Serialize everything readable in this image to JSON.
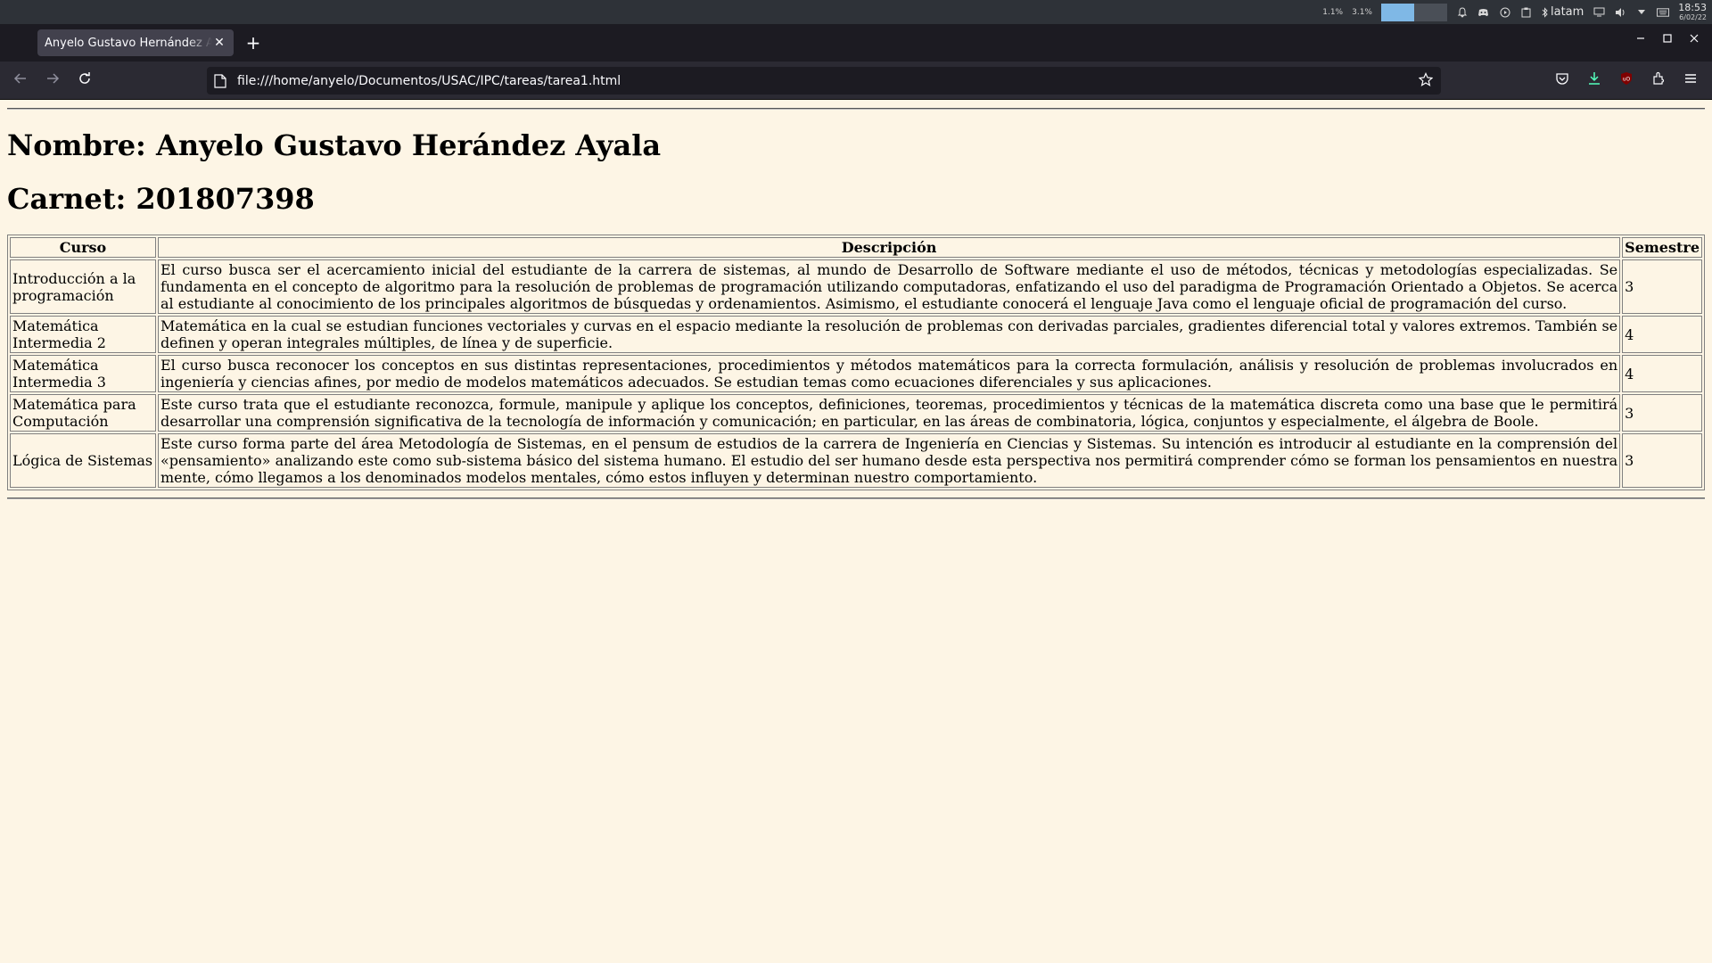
{
  "system_panel": {
    "cpu": "1.1%",
    "net": "3.1%",
    "mem_fill": 0.5,
    "keyboard": "latam",
    "time": "18:53",
    "date": "6/02/22"
  },
  "browser": {
    "tab_title": "Anyelo Gustavo Hernández Ayala",
    "url": "file:///home/anyelo/Documentos/USAC/IPC/tareas/tarea1.html",
    "accent": "#2b2a33"
  },
  "page": {
    "name_heading": "Nombre: Anyelo Gustavo Herández Ayala",
    "carnet_heading": "Carnet: 201807398",
    "table": {
      "headers": [
        "Curso",
        "Descripción",
        "Semestre"
      ],
      "rows": [
        {
          "curso": "Introducción a la programación",
          "descripcion": "El curso busca ser el acercamiento inicial del estudiante de la carrera de sistemas, al mundo de Desarrollo de Software mediante el uso de métodos, técnicas y metodologías especializadas. Se fundamenta en el concepto de algoritmo para la resolución de problemas de programación utilizando computadoras, enfatizando el uso del paradigma de Programación Orientado a Objetos. Se acerca al estudiante al conocimiento de los principales algoritmos de búsquedas y ordenamientos. Asimismo, el estudiante conocerá el lenguaje Java como el lenguaje oficial de programación del curso.",
          "semestre": "3"
        },
        {
          "curso": "Matemática Intermedia 2",
          "descripcion": "Matemática en la cual se estudian funciones vectoriales y curvas en el espacio mediante la resolución de problemas con derivadas parciales, gradientes diferencial total y valores extremos. También se definen y operan integrales múltiples, de línea y de superficie.",
          "semestre": "4"
        },
        {
          "curso": "Matemática Intermedia 3",
          "descripcion": "El curso busca reconocer los conceptos en sus distintas representaciones, procedimientos y métodos matemáticos para la correcta formulación, análisis y resolución de problemas involucrados en ingeniería y ciencias afines, por medio de modelos matemáticos adecuados. Se estudian temas como ecuaciones diferenciales y sus aplicaciones.",
          "semestre": "4"
        },
        {
          "curso": "Matemática para Computación",
          "descripcion": "Este curso trata que el estudiante reconozca, formule, manipule y aplique los conceptos, definiciones, teoremas, procedimientos y técnicas de la matemática discreta como una base que le permitirá desarrollar una comprensión significativa de la tecnología de información y comunicación; en particular, en las áreas de combinatoria, lógica, conjuntos y especialmente, el álgebra de Boole.",
          "semestre": "3"
        },
        {
          "curso": "Lógica de Sistemas",
          "descripcion": "Este curso forma parte del área Metodología de Sistemas, en el pensum de estudios de la carrera de Ingeniería en Ciencias y Sistemas. Su intención es introducir al estudiante en la comprensión del «pensamiento» analizando este como sub-sistema básico del sistema humano. El estudio del ser humano desde esta perspectiva nos permitirá comprender cómo se forman los pensamientos en nuestra mente, cómo llegamos a los denominados modelos mentales, cómo estos influyen y determinan nuestro comportamiento.",
          "semestre": "3"
        }
      ]
    },
    "background_color": "#fdf5e5"
  }
}
